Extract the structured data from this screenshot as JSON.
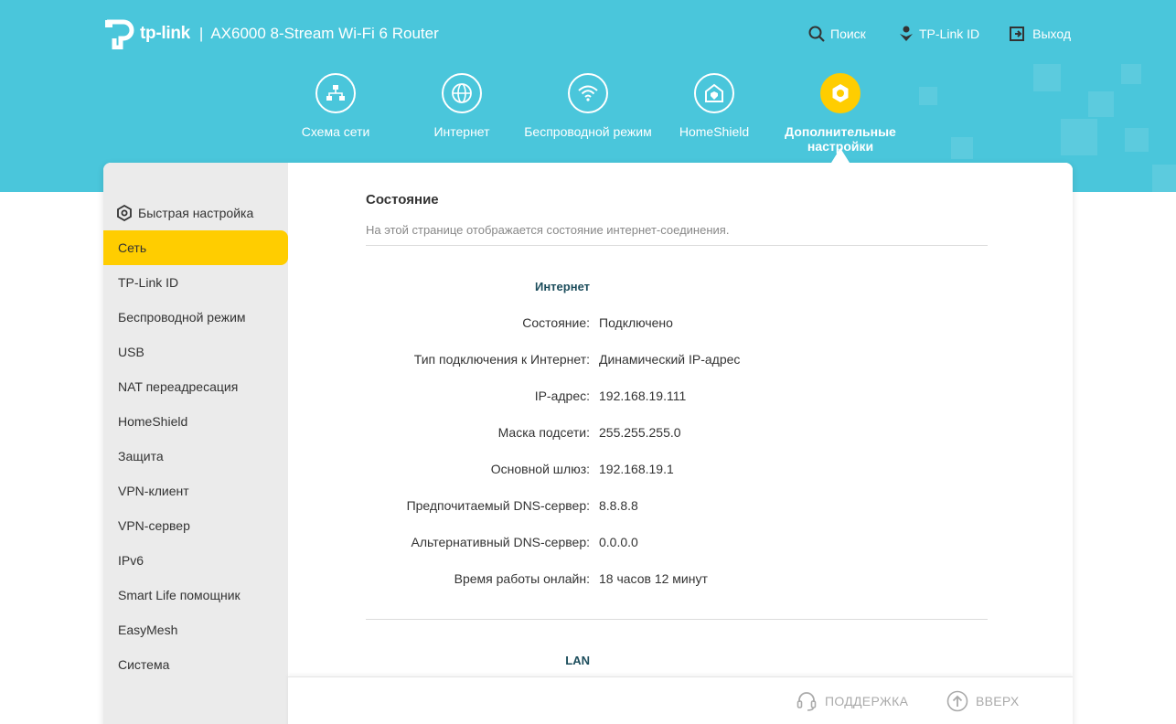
{
  "header": {
    "brand": "tp-link",
    "separator": "|",
    "model": "AX6000 8-Stream Wi-Fi 6 Router",
    "links": {
      "search": "Поиск",
      "tplink_id": "TP-Link ID",
      "logout": "Выход"
    },
    "accent_color": "#4ac6db",
    "active_color": "#ffcd00"
  },
  "nav": [
    {
      "label": "Схема сети",
      "icon": "network-map-icon"
    },
    {
      "label": "Интернет",
      "icon": "globe-icon"
    },
    {
      "label": "Беспроводной режим",
      "icon": "wifi-icon"
    },
    {
      "label": "HomeShield",
      "icon": "home-shield-icon"
    },
    {
      "label": "Дополнительные настройки",
      "icon": "advanced-gear-icon",
      "active": true
    }
  ],
  "sidebar": {
    "quick_setup": "Быстрая настройка",
    "items": [
      "Сеть",
      "TP-Link ID",
      "Беспроводной режим",
      "USB",
      "NAT переадресация",
      "HomeShield",
      "Защита",
      "VPN-клиент",
      "VPN-сервер",
      "IPv6",
      "Smart Life помощник",
      "EasyMesh",
      "Система"
    ],
    "active_index": 0
  },
  "main": {
    "title": "Состояние",
    "description": "На этой странице отображается состояние интернет-соединения.",
    "internet": {
      "title": "Интернет",
      "rows": [
        {
          "label": "Состояние:",
          "value": "Подключено"
        },
        {
          "label": "Тип подключения к Интернет:",
          "value": "Динамический IP-адрес"
        },
        {
          "label": "IP-адрес:",
          "value": "192.168.19.111"
        },
        {
          "label": "Маска подсети:",
          "value": "255.255.255.0"
        },
        {
          "label": "Основной шлюз:",
          "value": "192.168.19.1"
        },
        {
          "label": "Предпочитаемый DNS-сервер:",
          "value": "8.8.8.8"
        },
        {
          "label": "Альтернативный DNS-сервер:",
          "value": "0.0.0.0"
        },
        {
          "label": "Время работы онлайн:",
          "value": "18 часов 12 минут"
        }
      ]
    },
    "lan": {
      "title": "LAN"
    }
  },
  "footer": {
    "support": "ПОДДЕРЖКА",
    "top": "ВВЕРХ"
  }
}
